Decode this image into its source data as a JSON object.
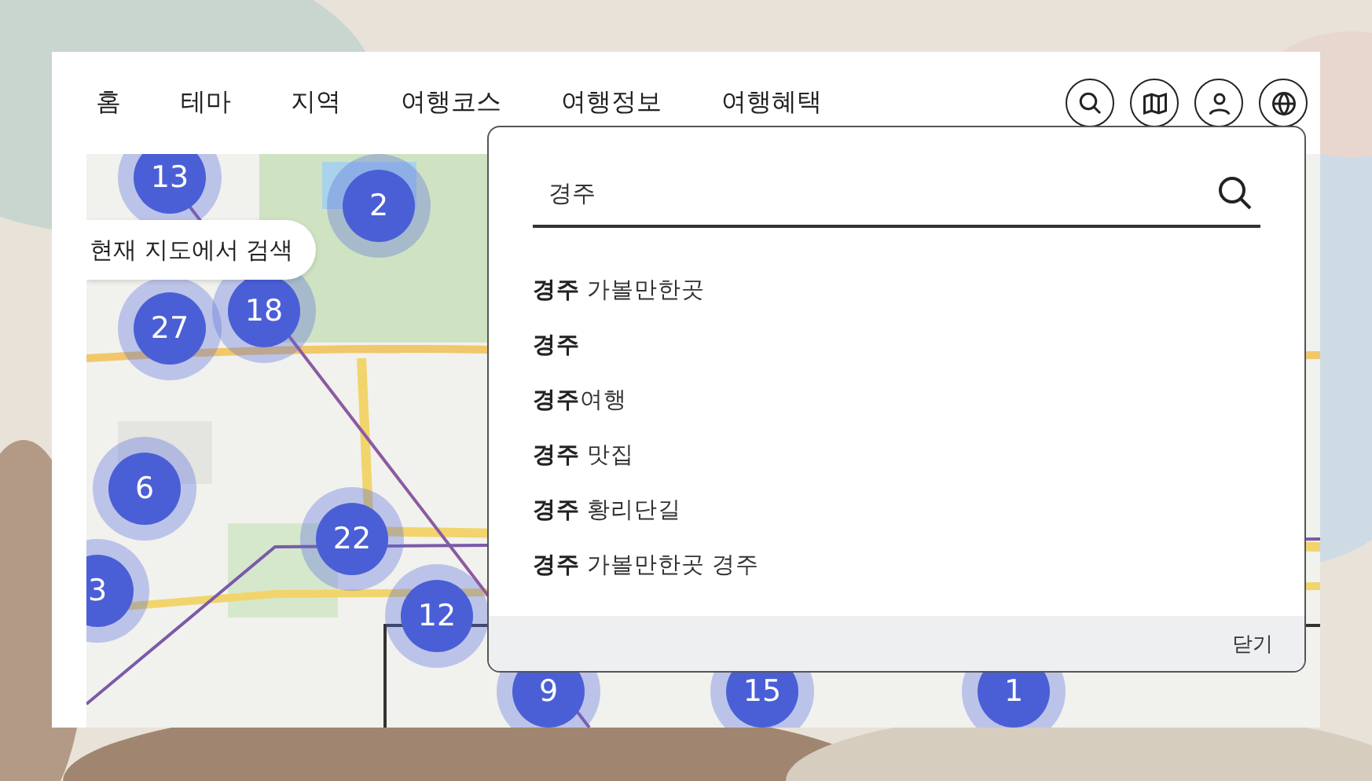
{
  "nav": {
    "items": [
      {
        "label": "홈"
      },
      {
        "label": "테마"
      },
      {
        "label": "지역"
      },
      {
        "label": "여행코스"
      },
      {
        "label": "여행정보"
      },
      {
        "label": "여행혜택"
      }
    ]
  },
  "map": {
    "search_here": "현재 지도에서 검색",
    "clusters": [
      {
        "count": "13"
      },
      {
        "count": "2"
      },
      {
        "count": "27"
      },
      {
        "count": "18"
      },
      {
        "count": "6"
      },
      {
        "count": "22"
      },
      {
        "count": "3"
      },
      {
        "count": "12"
      },
      {
        "count": "9"
      },
      {
        "count": "15"
      },
      {
        "count": "1"
      }
    ]
  },
  "search": {
    "value": "경주",
    "suggestions": [
      "**경주** 가볼만한곳",
      "**경주**",
      "**경주**여행",
      "**경주** 맛집",
      "**경주** 황리단길",
      "**경주** 가볼만한곳 경주"
    ],
    "close": "닫기"
  }
}
